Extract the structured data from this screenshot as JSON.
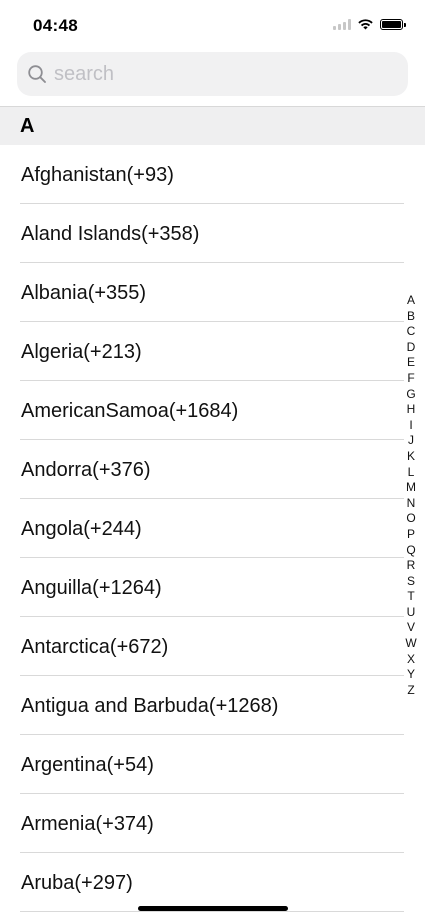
{
  "status_bar": {
    "time": "04:48",
    "icons": [
      "signal-icon",
      "wifi-icon",
      "battery-icon"
    ]
  },
  "search": {
    "placeholder": "search",
    "value": "",
    "icon": "search-icon"
  },
  "section": {
    "title": "A"
  },
  "countries": [
    "Afghanistan(+93)",
    "Aland Islands(+358)",
    "Albania(+355)",
    "Algeria(+213)",
    "AmericanSamoa(+1684)",
    "Andorra(+376)",
    "Angola(+244)",
    "Anguilla(+1264)",
    "Antarctica(+672)",
    "Antigua and Barbuda(+1268)",
    "Argentina(+54)",
    "Armenia(+374)",
    "Aruba(+297)"
  ],
  "index_letters": [
    "A",
    "B",
    "C",
    "D",
    "E",
    "F",
    "G",
    "H",
    "I",
    "J",
    "K",
    "L",
    "M",
    "N",
    "O",
    "P",
    "Q",
    "R",
    "S",
    "T",
    "U",
    "V",
    "W",
    "X",
    "Y",
    "Z"
  ],
  "colors": {
    "search_background": "#f1f1f2",
    "section_header_background": "#efeff0",
    "separator": "#d9d9d9",
    "placeholder": "#c0c0c5"
  }
}
